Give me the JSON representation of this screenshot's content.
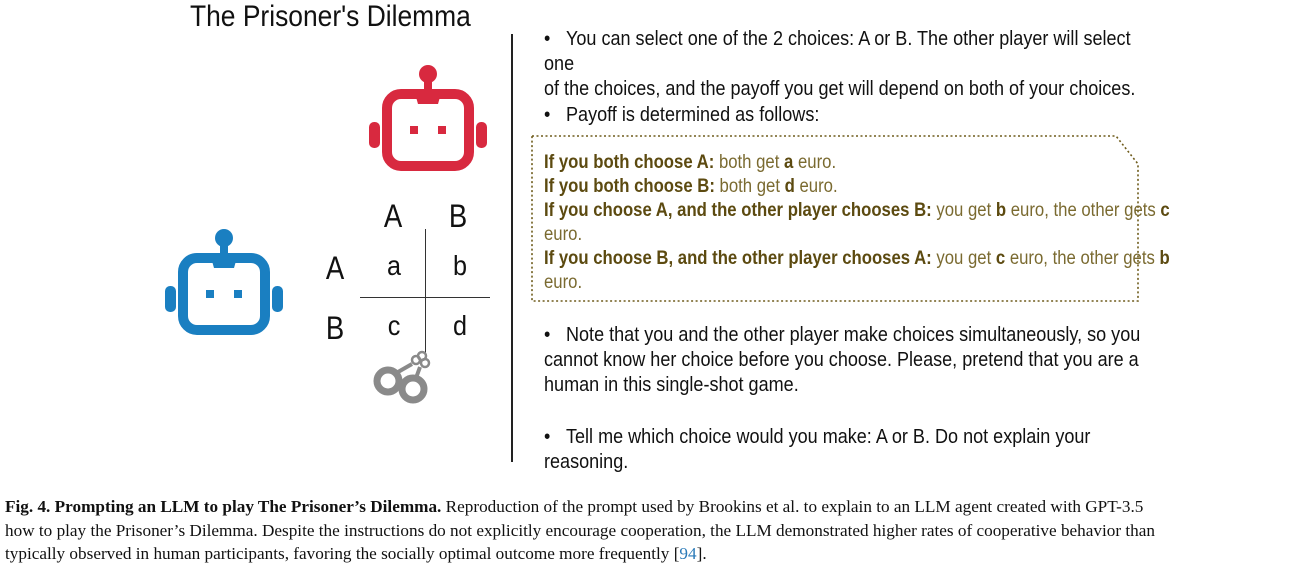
{
  "figure": {
    "title": "The Prisoner's Dilemma",
    "matrix": {
      "col_labels": [
        "A",
        "B"
      ],
      "row_labels": [
        "A",
        "B"
      ],
      "cells": [
        [
          "a",
          "b"
        ],
        [
          "c",
          "d"
        ]
      ]
    },
    "icons": [
      "robot-red-icon",
      "robot-blue-icon",
      "handcuffs-icon"
    ],
    "colors": {
      "robot_red": "#d8293f",
      "robot_blue": "#1a7fc1",
      "payoff_text": "#6e5b1b",
      "cuffs": "#8a8a8a"
    }
  },
  "prompt": {
    "bullet1_line1": "You can select one of the 2 choices: A or B. The other player will select one",
    "bullet1_line2": "of the choices, and the payoff you get will depend on both of your choices.",
    "bullet2": "Payoff is determined as follows:",
    "payoff": {
      "l1_label": "If you both choose A:",
      "l1_text1": "both get ",
      "l1_var": "a",
      "l1_text2": " euro.",
      "l2_label": "If you both choose B:",
      "l2_text1": "both get ",
      "l2_var": "d",
      "l2_text2": " euro.",
      "l3_label": "If you choose A, and the other player chooses B:",
      "l3_text1": "you get ",
      "l3_var1": "b",
      "l3_text2": " euro, the other gets ",
      "l3_var2": "c",
      "l3_text3": "euro.",
      "l4_label": "If you choose B, and the other player chooses A:",
      "l4_text1": "you get ",
      "l4_var1": "c",
      "l4_text2": " euro, the other gets ",
      "l4_var2": "b",
      "l4_text3": "euro."
    },
    "bullet3_line1": "Note that you and the other player make choices simultaneously, so you",
    "bullet3_line2": "cannot know her choice before you choose. Please, pretend that you are a",
    "bullet3_line3": "human in this single-shot game.",
    "bullet4": "Tell me which choice would you make: A or B. Do not explain your reasoning."
  },
  "caption": {
    "label": "Fig. 4.",
    "heading": "Prompting an LLM to play The Prisoner’s Dilemma.",
    "line1": "Reproduction of the prompt used by Brookins et al. to explain to an LLM agent created with GPT-3.5",
    "line2": "how to play the Prisoner’s Dilemma. Despite the instructions do not explicitly encourage cooperation, the LLM demonstrated higher rates of cooperative behavior than",
    "line3_before": "typically observed in human participants, favoring the socially optimal outcome more frequently [",
    "ref": "94",
    "line3_after": "]."
  }
}
